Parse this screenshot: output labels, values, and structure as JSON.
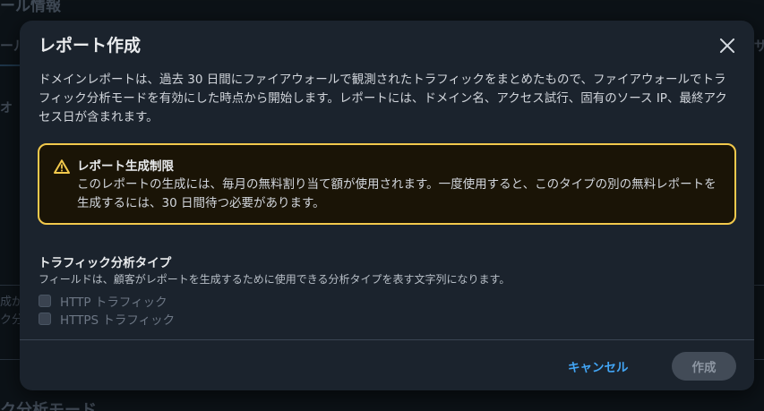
{
  "background": {
    "heading_top": "ール情報",
    "tab_left": "ール",
    "tab_right": "ザ",
    "left_fragment_1": "オ",
    "left_fragment_2": "成が",
    "left_fragment_3": "ク分",
    "heading_bottom": "ク分析モード"
  },
  "modal": {
    "title": "レポート作成",
    "description": "ドメインレポートは、過去 30 日間にファイアウォールで観測されたトラフィックをまとめたもので、ファイアウォールでトラフィック分析モードを有効にした時点から開始します。レポートには、ドメイン名、アクセス試行、固有のソース IP、最終アクセス日が含まれます。",
    "alert": {
      "icon": "warning-icon",
      "title": "レポート生成制限",
      "body": "このレポートの生成には、毎月の無料割り当て額が使用されます。一度使用すると、このタイプの別の無料レポートを生成するには、30 日間待つ必要があります。"
    },
    "field": {
      "label": "トラフィック分析タイプ",
      "description": "フィールドは、顧客がレポートを生成するために使用できる分析タイプを表す文字列になります。",
      "options": [
        {
          "label": "HTTP トラフィック",
          "checked": false
        },
        {
          "label": "HTTPS トラフィック",
          "checked": false
        }
      ]
    },
    "cancel_label": "キャンセル",
    "create_label": "作成"
  },
  "colors": {
    "accent": "#42a5f5",
    "warning_border": "#f2c94c",
    "modal_bg": "#1b232d"
  }
}
